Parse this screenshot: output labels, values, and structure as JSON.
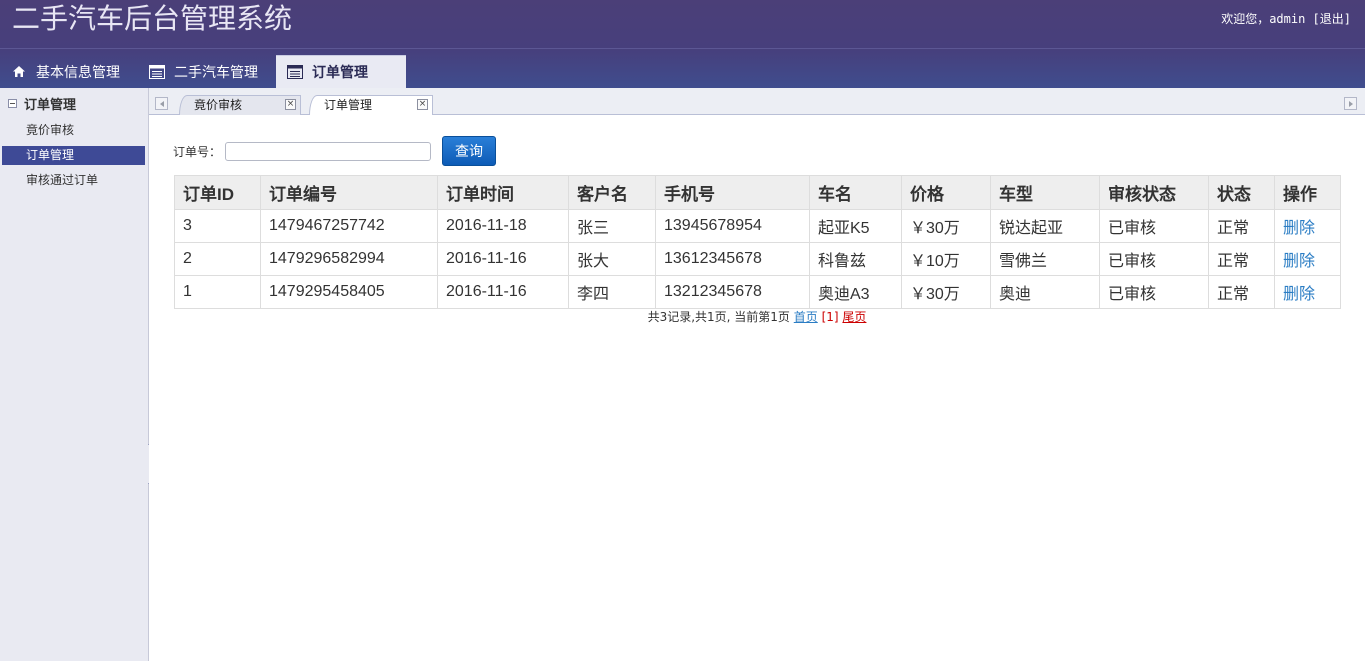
{
  "header": {
    "title": "二手汽车后台管理系统",
    "welcome": "欢迎您，admin",
    "logout": "[退出]"
  },
  "top_nav": [
    {
      "label": "基本信息管理",
      "icon": "home-icon"
    },
    {
      "label": "二手汽车管理",
      "icon": "list-icon"
    },
    {
      "label": "订单管理",
      "icon": "list-icon"
    }
  ],
  "sidebar": {
    "title": "订单管理",
    "items": [
      {
        "label": "竟价审核"
      },
      {
        "label": "订单管理"
      },
      {
        "label": "审核通过订单"
      }
    ]
  },
  "tabs": [
    {
      "label": "竟价审核"
    },
    {
      "label": "订单管理"
    }
  ],
  "search": {
    "label": "订单号：",
    "value": "",
    "placeholder": "",
    "button": "查询"
  },
  "table": {
    "columns": [
      "订单ID",
      "订单编号",
      "订单时间",
      "客户名",
      "手机号",
      "车名",
      "价格",
      "车型",
      "审核状态",
      "状态",
      "操作"
    ],
    "rows": [
      {
        "id": "3",
        "number": "1479467257742",
        "time": "2016-11-18",
        "customer": "张三",
        "phone": "13945678954",
        "car": "起亚K5",
        "price": "￥30万",
        "model": "锐达起亚",
        "audit": "已审核",
        "status": "正常",
        "action": "删除"
      },
      {
        "id": "2",
        "number": "1479296582994",
        "time": "2016-11-16",
        "customer": "张大",
        "phone": "13612345678",
        "car": "科鲁兹",
        "price": "￥10万",
        "model": "雪佛兰",
        "audit": "已审核",
        "status": "正常",
        "action": "删除"
      },
      {
        "id": "1",
        "number": "1479295458405",
        "time": "2016-11-16",
        "customer": "李四",
        "phone": "13212345678",
        "car": "奥迪A3",
        "price": "￥30万",
        "model": "奥迪",
        "audit": "已审核",
        "status": "正常",
        "action": "删除"
      }
    ]
  },
  "pager": {
    "summary": "共3记录,共1页, 当前第1页",
    "first": "首页",
    "current": "[1]",
    "last": "尾页"
  },
  "colors": {
    "header_bg": "#473f7c",
    "sidebar_active": "#3e4a96",
    "link": "#2b7dc4",
    "pager_current": "#cc0000",
    "button": "#0d5bb6"
  }
}
